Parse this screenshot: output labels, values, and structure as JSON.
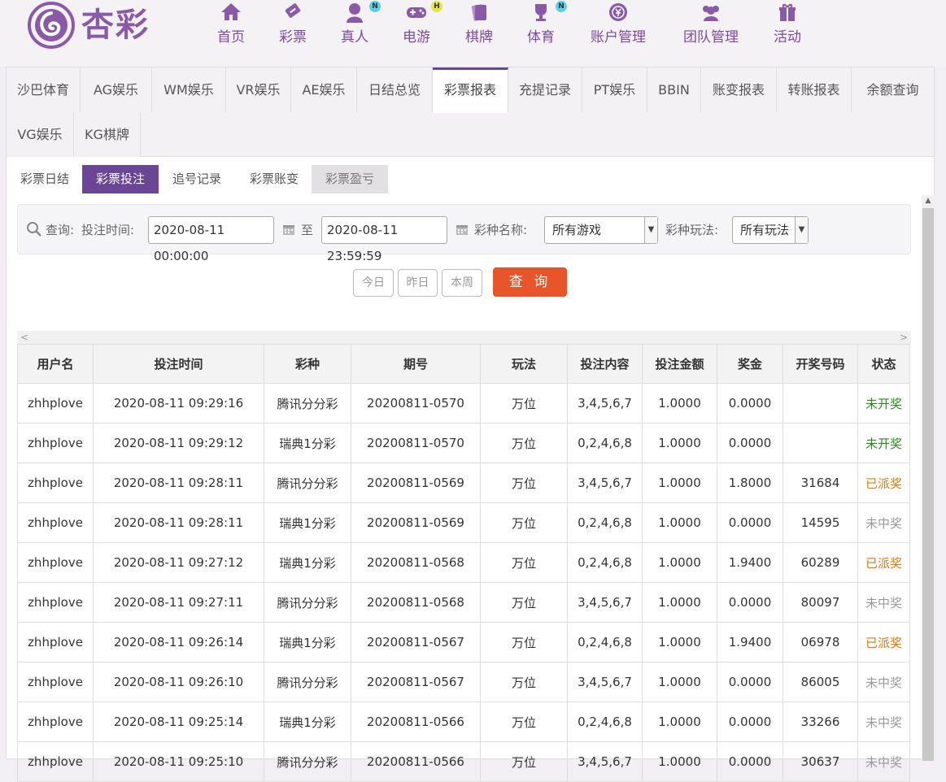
{
  "brand": {
    "name": "杏彩"
  },
  "nav": [
    {
      "label": "首页",
      "icon": "home-icon"
    },
    {
      "label": "彩票",
      "icon": "ticket-icon"
    },
    {
      "label": "真人",
      "icon": "dealer-icon",
      "badge": "N"
    },
    {
      "label": "电游",
      "icon": "gamepad-icon",
      "badge": "H"
    },
    {
      "label": "棋牌",
      "icon": "cards-icon"
    },
    {
      "label": "体育",
      "icon": "trophy-icon",
      "badge": "N"
    },
    {
      "label": "账户管理",
      "icon": "account-icon"
    },
    {
      "label": "团队管理",
      "icon": "team-icon"
    },
    {
      "label": "活动",
      "icon": "gift-icon"
    }
  ],
  "tabs": [
    "沙巴体育",
    "AG娱乐",
    "WM娱乐",
    "VR娱乐",
    "AE娱乐",
    "日结总览",
    "彩票报表",
    "充提记录",
    "PT娱乐",
    "BBIN",
    "账变报表",
    "转账报表",
    "余额查询",
    "VG娱乐",
    "KG棋牌"
  ],
  "active_tab": "彩票报表",
  "subtabs": [
    "彩票日结",
    "彩票投注",
    "追号记录",
    "彩票账变",
    "彩票盈亏"
  ],
  "active_subtab": "彩票投注",
  "search": {
    "query_label": "查询:",
    "time_label": "投注时间:",
    "start_time": "2020-08-11 00:00:00",
    "to_label": "至",
    "end_time": "2020-08-11 23:59:59",
    "lottery_label": "彩种名称:",
    "lottery_value": "所有游戏",
    "play_label": "彩种玩法:",
    "play_value": "所有玩法"
  },
  "quick": {
    "today": "今日",
    "yesterday": "昨日",
    "week": "本周",
    "submit": "查 询"
  },
  "table": {
    "headers": [
      "用户名",
      "投注时间",
      "彩种",
      "期号",
      "玩法",
      "投注内容",
      "投注金额",
      "奖金",
      "开奖号码",
      "状态"
    ],
    "rows": [
      [
        "zhhplove",
        "2020-08-11 09:29:16",
        "腾讯分分彩",
        "20200811-0570",
        "万位",
        "3,4,5,6,7",
        "1.0000",
        "0.0000",
        "",
        "未开奖"
      ],
      [
        "zhhplove",
        "2020-08-11 09:29:12",
        "瑞典1分彩",
        "20200811-0570",
        "万位",
        "0,2,4,6,8",
        "1.0000",
        "0.0000",
        "",
        "未开奖"
      ],
      [
        "zhhplove",
        "2020-08-11 09:28:11",
        "腾讯分分彩",
        "20200811-0569",
        "万位",
        "3,4,5,6,7",
        "1.0000",
        "1.8000",
        "31684",
        "已派奖"
      ],
      [
        "zhhplove",
        "2020-08-11 09:28:11",
        "瑞典1分彩",
        "20200811-0569",
        "万位",
        "0,2,4,6,8",
        "1.0000",
        "0.0000",
        "14595",
        "未中奖"
      ],
      [
        "zhhplove",
        "2020-08-11 09:27:12",
        "瑞典1分彩",
        "20200811-0568",
        "万位",
        "0,2,4,6,8",
        "1.0000",
        "1.9400",
        "60289",
        "已派奖"
      ],
      [
        "zhhplove",
        "2020-08-11 09:27:11",
        "腾讯分分彩",
        "20200811-0568",
        "万位",
        "3,4,5,6,7",
        "1.0000",
        "0.0000",
        "80097",
        "未中奖"
      ],
      [
        "zhhplove",
        "2020-08-11 09:26:14",
        "瑞典1分彩",
        "20200811-0567",
        "万位",
        "0,2,4,6,8",
        "1.0000",
        "1.9400",
        "06978",
        "已派奖"
      ],
      [
        "zhhplove",
        "2020-08-11 09:26:10",
        "腾讯分分彩",
        "20200811-0567",
        "万位",
        "3,4,5,6,7",
        "1.0000",
        "0.0000",
        "86005",
        "未中奖"
      ],
      [
        "zhhplove",
        "2020-08-11 09:25:14",
        "瑞典1分彩",
        "20200811-0566",
        "万位",
        "0,2,4,6,8",
        "1.0000",
        "0.0000",
        "33266",
        "未中奖"
      ],
      [
        "zhhplove",
        "2020-08-11 09:25:10",
        "腾讯分分彩",
        "20200811-0566",
        "万位",
        "3,4,5,6,7",
        "1.0000",
        "0.0000",
        "30637",
        "未中奖"
      ]
    ]
  },
  "colors": {
    "accent": "#6a4694",
    "submit": "#e8552a",
    "pending": "#2a8a1e",
    "paid": "#e07a10",
    "lost": "#999999"
  }
}
